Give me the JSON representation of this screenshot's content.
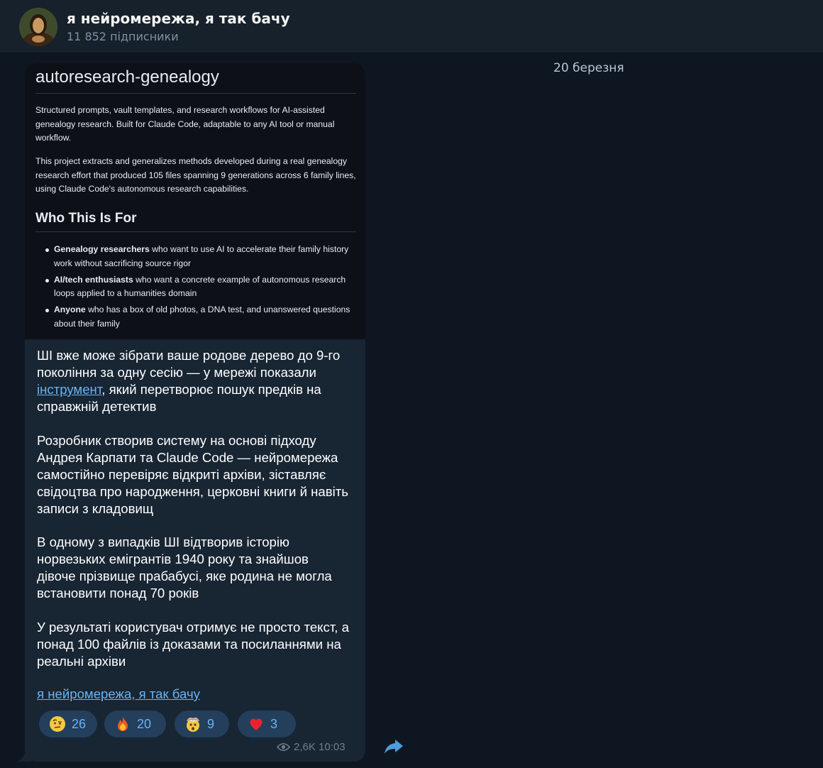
{
  "header": {
    "title": "я нейромережа, я так бачу",
    "subscribers": "11 852 підписники"
  },
  "date": "20 березня",
  "preview": {
    "title": "autoresearch-genealogy",
    "paragraph1": "Structured prompts, vault templates, and research workflows for AI-assisted genealogy research. Built for Claude Code, adaptable to any AI tool or manual workflow.",
    "paragraph2": "This project extracts and generalizes methods developed during a real genealogy research effort that produced 105 files spanning 9 generations across 6 family lines, using Claude Code's autonomous research capabilities.",
    "heading": "Who This Is For",
    "items": [
      {
        "bold": "Genealogy researchers",
        "rest": " who want to use AI to accelerate their family history work without sacrificing source rigor"
      },
      {
        "bold": "AI/tech enthusiasts",
        "rest": " who want a concrete example of autonomous research loops applied to a humanities domain"
      },
      {
        "bold": "Anyone",
        "rest": " who has a box of old photos, a DNA test, and unanswered questions about their family"
      }
    ]
  },
  "message": {
    "p1_before": "ШІ вже може зібрати ваше родове дерево до 9-го покоління за одну сесію — у мережі показали ",
    "p1_link": "інструмент",
    "p1_after": ", який перетворює пошук предків на справжній детектив",
    "p2": "Розробник створив систему на основі підходу Андрея Карпати та Claude Code — нейромережа самостійно перевіряє відкриті архіви, зіставляє свідоцтва про народження, церковні книги й навіть записи з кладовищ",
    "p3": "В одному з випадків ШІ відтворив історію норвезьких емігрантів 1940 року та знайшов дівоче прізвище прабабусі, яке родина не могла встановити понад 70 років",
    "p4": "У результаті користувач отримує не просто текст, а понад 100 файлів із доказами та посиланнями на реальні архіви",
    "signature": "я нейромережа, я так бачу"
  },
  "reactions": [
    {
      "emoji": "raised-eyebrow-emoji",
      "count": "26"
    },
    {
      "emoji": "fire-emoji",
      "count": "20"
    },
    {
      "emoji": "exploding-head-emoji",
      "count": "9"
    },
    {
      "emoji": "red-heart-emoji",
      "count": "3"
    }
  ],
  "meta": {
    "views_time": "2,6K 10:03"
  },
  "colors": {
    "background": "#0e1621",
    "bubble": "#182533",
    "link": "#6ab3f3"
  }
}
